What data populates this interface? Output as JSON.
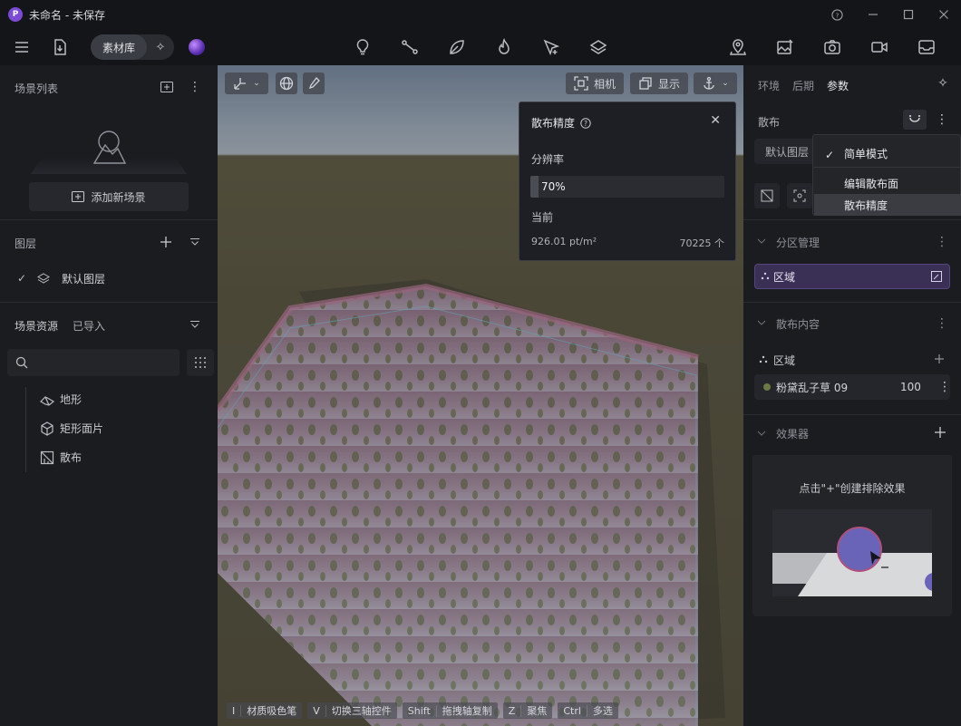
{
  "window": {
    "app_logo_letter": "P",
    "title": "未命名 - 未保存",
    "controls": [
      "?",
      "—",
      "☐",
      "✕"
    ]
  },
  "toolbar": {
    "library_label": "素材库",
    "icons": [
      "menu-icon",
      "import-icon",
      "ai-sparkle-icon",
      "light-bulb-icon",
      "path-icon",
      "leaf-icon",
      "fire-icon",
      "pointer-plus-icon",
      "layers-icon",
      "map-pin-icon",
      "image-edit-icon",
      "camera-icon",
      "video-icon",
      "inbox-icon"
    ]
  },
  "left_panel": {
    "scene_list_title": "场景列表",
    "add_scene_label": "添加新场景",
    "layers_title": "图层",
    "default_layer": "默认图层",
    "resources_title": "场景资源",
    "resources_tab_imported": "已导入",
    "search_placeholder": "",
    "tree": [
      {
        "label": "地形",
        "icon": "terrain-icon"
      },
      {
        "label": "矩形面片",
        "icon": "cube-icon"
      },
      {
        "label": "散布",
        "icon": "scatter-icon"
      }
    ]
  },
  "viewport": {
    "btn_camera": "相机",
    "btn_display": "显示",
    "hints": [
      {
        "key": "I",
        "text": "材质吸色笔"
      },
      {
        "key": "V",
        "text": "切换三轴控件"
      },
      {
        "key": "Shift",
        "text": "拖拽轴复制"
      },
      {
        "key": "Z",
        "text": "聚焦"
      },
      {
        "key": "Ctrl",
        "text": "多选"
      }
    ]
  },
  "popup": {
    "title": "散布精度",
    "resolution_label": "分辨率",
    "resolution_value": "70%",
    "resolution_fraction": 0.04,
    "current_label": "当前",
    "current_density": "926.01 pt/m²",
    "current_count": "70225 个"
  },
  "right_panel": {
    "tabs": [
      {
        "label": "环境",
        "active": false
      },
      {
        "label": "后期",
        "active": false
      },
      {
        "label": "参数",
        "active": true
      }
    ],
    "scatter_title": "散布",
    "default_layer": "默认图层",
    "zone_mgmt_title": "分区管理",
    "zone_label": "区域",
    "scatter_content_title": "散布内容",
    "content_zone_label": "区域",
    "item_name": "粉黛乱子草 09",
    "item_count": "100",
    "effects_title": "效果器",
    "effects_hint": "点击\"+\"创建排除效果"
  },
  "menu": {
    "items": [
      {
        "label": "简单模式",
        "checked": true
      },
      {
        "label": "编辑散布面",
        "checked": false
      },
      {
        "label": "散布精度",
        "checked": false,
        "highlighted": true
      }
    ]
  },
  "colors": {
    "accent_purple": "#7b4bd6",
    "zone_bg": "#3a2f55",
    "panel_bg": "#1b1c20"
  }
}
